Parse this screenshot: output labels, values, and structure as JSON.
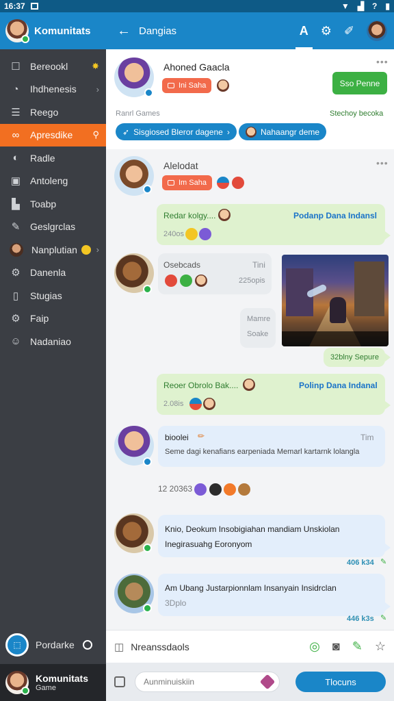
{
  "status": {
    "time": "16:37"
  },
  "sidebar": {
    "title": "Komunitats",
    "items": [
      {
        "label": "Bereookl",
        "icon": "square-icon"
      },
      {
        "label": "Ihdhenesis",
        "icon": "clock-icon"
      },
      {
        "label": "Reego",
        "icon": "bars-icon"
      },
      {
        "label": "Apresdike",
        "icon": "link-icon",
        "active": true
      },
      {
        "label": "Radle",
        "icon": "mic-icon"
      },
      {
        "label": "Antoleng",
        "icon": "lock-icon"
      },
      {
        "label": "Toabp",
        "icon": "chart-icon"
      },
      {
        "label": "Geslgrclas",
        "icon": "pencil-icon"
      },
      {
        "label": "Nanplutian",
        "icon": "avatar-icon"
      },
      {
        "label": "Danenla",
        "icon": "gear-icon"
      },
      {
        "label": "Stugias",
        "icon": "book-icon"
      },
      {
        "label": "Faip",
        "icon": "gear-icon"
      },
      {
        "label": "Nadaniao",
        "icon": "users-icon"
      }
    ],
    "bottom_item": "Pordarke",
    "profile_name": "Komunitats",
    "profile_sub": "Game"
  },
  "header": {
    "title": "Dangias"
  },
  "profile_card": {
    "name": "Ahoned Gaacla",
    "tag": "Ini Saha",
    "button": "Sso Penne",
    "section_left": "Ranrl Games",
    "section_right": "Stechoy becoka",
    "chip1": "Sisgiosed Bleror dagene",
    "chip2": "Nahaangr deme"
  },
  "post": {
    "name": "Alelodat",
    "tag": "Im Saha"
  },
  "messages": {
    "m1_title": "Redar kolgy....",
    "m1_link": "Podanp Dana Indansl",
    "m1_time": "240os",
    "m2_title": "Osebcads",
    "m2_right": "Tini",
    "m2_time": "225opis",
    "m3_line1": "Mamre",
    "m3_line2": "Soake",
    "m3_caption": "32blny Sepure",
    "m4_title": "Reoer Obrolo Bak....",
    "m4_link": "Polinp Dana Indanal",
    "m4_time": "2.08is",
    "m5_name": "bioolei",
    "m5_right": "Tim",
    "m5_text": "Seme dagi kenafians earpeniada Memarl kartarnk lolangla",
    "date_sep": "12 20363",
    "m6_line1": "Knio, Deokum Insobigiahan mandiam Unskiolan",
    "m6_line2": "Inegirasuahg Eoronyom",
    "m6_time": "406 k34",
    "m7_line1": "Am Ubang Justarpionnlam Insanyain Insidrclan",
    "m7_line2": "3Dplo",
    "m7_time": "446 k3s"
  },
  "input_row": {
    "label": "Nreanssdaols"
  },
  "composer": {
    "placeholder": "Aunminuiskiin",
    "send": "Tlocuns"
  }
}
